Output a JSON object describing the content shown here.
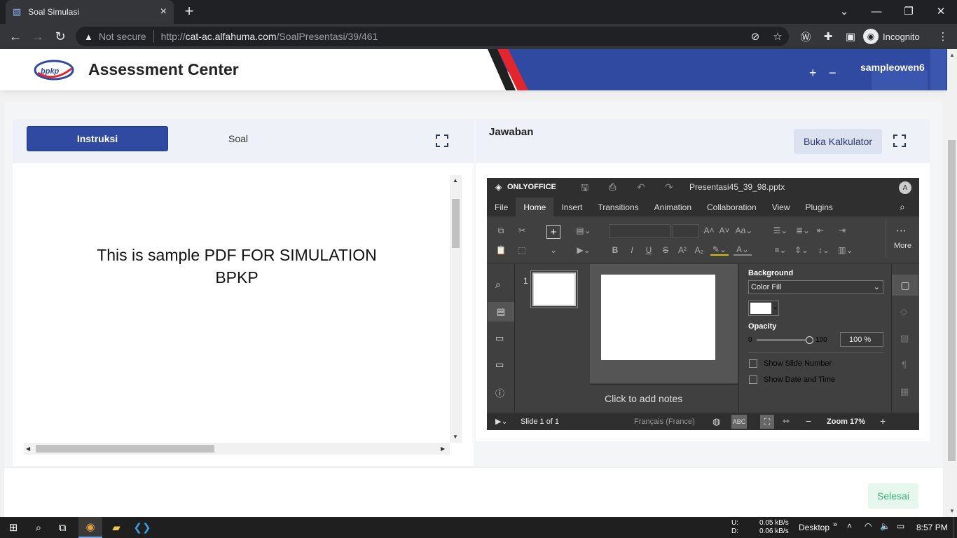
{
  "browser": {
    "tab_title": "Soal Simulasi",
    "security": "Not secure",
    "url_scheme": "http://",
    "url_host": "cat-ac.alfahuma.com",
    "url_path": "/SoalPresentasi/39/461",
    "profile": "Incognito"
  },
  "header": {
    "logo_text": "bpkp",
    "title": "Assessment Center",
    "zoom_in": "+",
    "zoom_out": "−",
    "username": "sampleowen6"
  },
  "left_panel": {
    "tab_instruksi": "Instruksi",
    "tab_soal": "Soal",
    "pdf_line1": "This is sample PDF FOR SIMULATION",
    "pdf_line2": "BPKP"
  },
  "right_panel": {
    "title": "Jawaban",
    "calc_button": "Buka Kalkulator"
  },
  "onlyoffice": {
    "brand": "ONLYOFFICE",
    "filename": "Presentasi45_39_98.pptx",
    "avatar": "A",
    "menu": [
      "File",
      "Home",
      "Insert",
      "Transitions",
      "Animation",
      "Collaboration",
      "View",
      "Plugins"
    ],
    "active_menu": "Home",
    "more": "More",
    "slide_index": "1",
    "notes_placeholder": "Click to add notes",
    "props": {
      "background_label": "Background",
      "fill_value": "Color Fill",
      "opacity_label": "Opacity",
      "opacity_min": "0",
      "opacity_max": "100",
      "opacity_value": "100 %",
      "show_slide_number": "Show Slide Number",
      "show_date_time": "Show Date and Time"
    },
    "status": {
      "slide_of": "Slide 1 of 1",
      "language": "Français (France)",
      "zoom": "Zoom 17%"
    }
  },
  "footer": {
    "finish_button": "Selesai"
  },
  "taskbar": {
    "net_up_label": "U:",
    "net_down_label": "D:",
    "net_up": "0.05 kB/s",
    "net_down": "0.06 kB/s",
    "desktop": "Desktop",
    "time": "8:57 PM"
  },
  "colors": {
    "brand_blue": "#2f4aa0",
    "brand_red": "#e3262d",
    "finish_green": "#3cb371"
  }
}
